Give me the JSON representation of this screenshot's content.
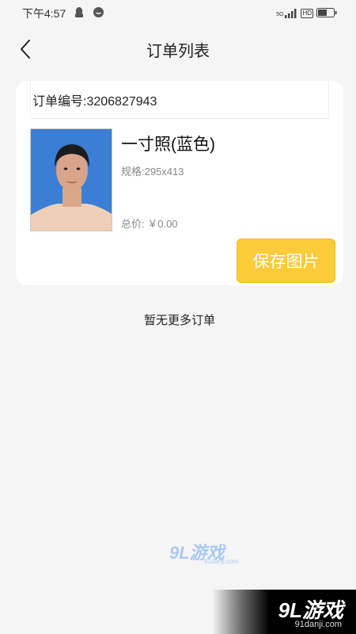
{
  "status_bar": {
    "time": "下午4:57",
    "icons": [
      "qq-icon",
      "message-bubble-icon",
      "signal-5g-icon",
      "hd-icon",
      "battery-icon"
    ],
    "network_label": "5G",
    "hd_label": "HD"
  },
  "nav": {
    "title": "订单列表",
    "back_icon": "chevron-left-icon"
  },
  "order": {
    "number_text": "订单编号:3206827943",
    "product_name": "一寸照(蓝色)",
    "spec_text": "规格:295x413",
    "price_text": "总价: ￥0.00",
    "photo_background": "#3b7fd4",
    "save_button_label": "保存图片",
    "save_button_color": "#fbcb38"
  },
  "footer_text": "暂无更多订单",
  "watermark": {
    "center_logo": "9L游戏",
    "center_site": "91danji.com",
    "corner_logo": "9L游戏",
    "corner_site": "91danji.com"
  }
}
